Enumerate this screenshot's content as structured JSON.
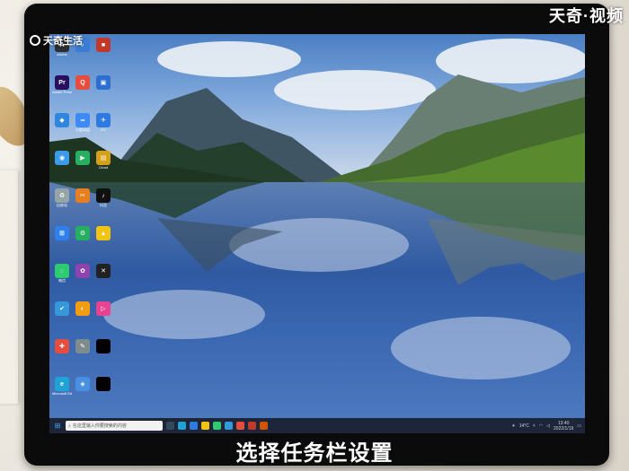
{
  "watermarks": {
    "left_text": "天奇生活",
    "right_text": "天奇·视频"
  },
  "caption": "选择任务栏设置",
  "desktop_icons": [
    {
      "label": "Adobe",
      "color": "#2e2e2e",
      "glyph": "A"
    },
    {
      "label": "",
      "color": "#3a7bd5",
      "glyph": "♪"
    },
    {
      "label": "",
      "color": "#c0392b",
      "glyph": "■"
    },
    {
      "label": "Adobe Premie",
      "color": "#2a0e5e",
      "glyph": "Pr"
    },
    {
      "label": "",
      "color": "#e74c3c",
      "glyph": "Q"
    },
    {
      "label": "",
      "color": "#2c6fd1",
      "glyph": "▣"
    },
    {
      "label": "",
      "color": "#2e86de",
      "glyph": "◆"
    },
    {
      "label": "百度网盘",
      "color": "#3d8af7",
      "glyph": "∞"
    },
    {
      "label": "EV",
      "color": "#2d7be0",
      "glyph": "✈"
    },
    {
      "label": "",
      "color": "#3b9be8",
      "glyph": "◉"
    },
    {
      "label": "",
      "color": "#27ae60",
      "glyph": "▶"
    },
    {
      "label": "Cloud",
      "color": "#d4a017",
      "glyph": "▤"
    },
    {
      "label": "回收站",
      "color": "#95a5a6",
      "glyph": "♻"
    },
    {
      "label": "",
      "color": "#e67e22",
      "glyph": "✂"
    },
    {
      "label": "抖音",
      "color": "#111111",
      "glyph": "♪"
    },
    {
      "label": "",
      "color": "#2f80ed",
      "glyph": "⊞"
    },
    {
      "label": "",
      "color": "#27ae60",
      "glyph": "⚙"
    },
    {
      "label": "",
      "color": "#f1c40f",
      "glyph": "▲"
    },
    {
      "label": "微信",
      "color": "#2ecc71",
      "glyph": "◌"
    },
    {
      "label": "",
      "color": "#8e44ad",
      "glyph": "✿"
    },
    {
      "label": "",
      "color": "#222222",
      "glyph": "✕"
    },
    {
      "label": "",
      "color": "#3498db",
      "glyph": "✔"
    },
    {
      "label": "",
      "color": "#f39c12",
      "glyph": "◐"
    },
    {
      "label": "",
      "color": "#e84393",
      "glyph": "▷"
    },
    {
      "label": "",
      "color": "#e74c3c",
      "glyph": "✚"
    },
    {
      "label": "",
      "color": "#7f8c8d",
      "glyph": "✎"
    },
    {
      "label": "",
      "color": "#000000",
      "glyph": ""
    },
    {
      "label": "Microsoft Edge",
      "color": "#1fa3d6",
      "glyph": "e"
    },
    {
      "label": "",
      "color": "#4a90e2",
      "glyph": "◈"
    },
    {
      "label": "",
      "color": "#000000",
      "glyph": ""
    }
  ],
  "taskbar": {
    "search_placeholder": "在这里输入你要搜索的内容",
    "weather": "14°C",
    "time": "13:40",
    "date": "2022/1/19"
  },
  "colors": {
    "monitor_bezel": "#0b0b0c",
    "taskbar": "#1c2638",
    "sky": "#4b7fc4",
    "lake": "#2f5aa2"
  }
}
